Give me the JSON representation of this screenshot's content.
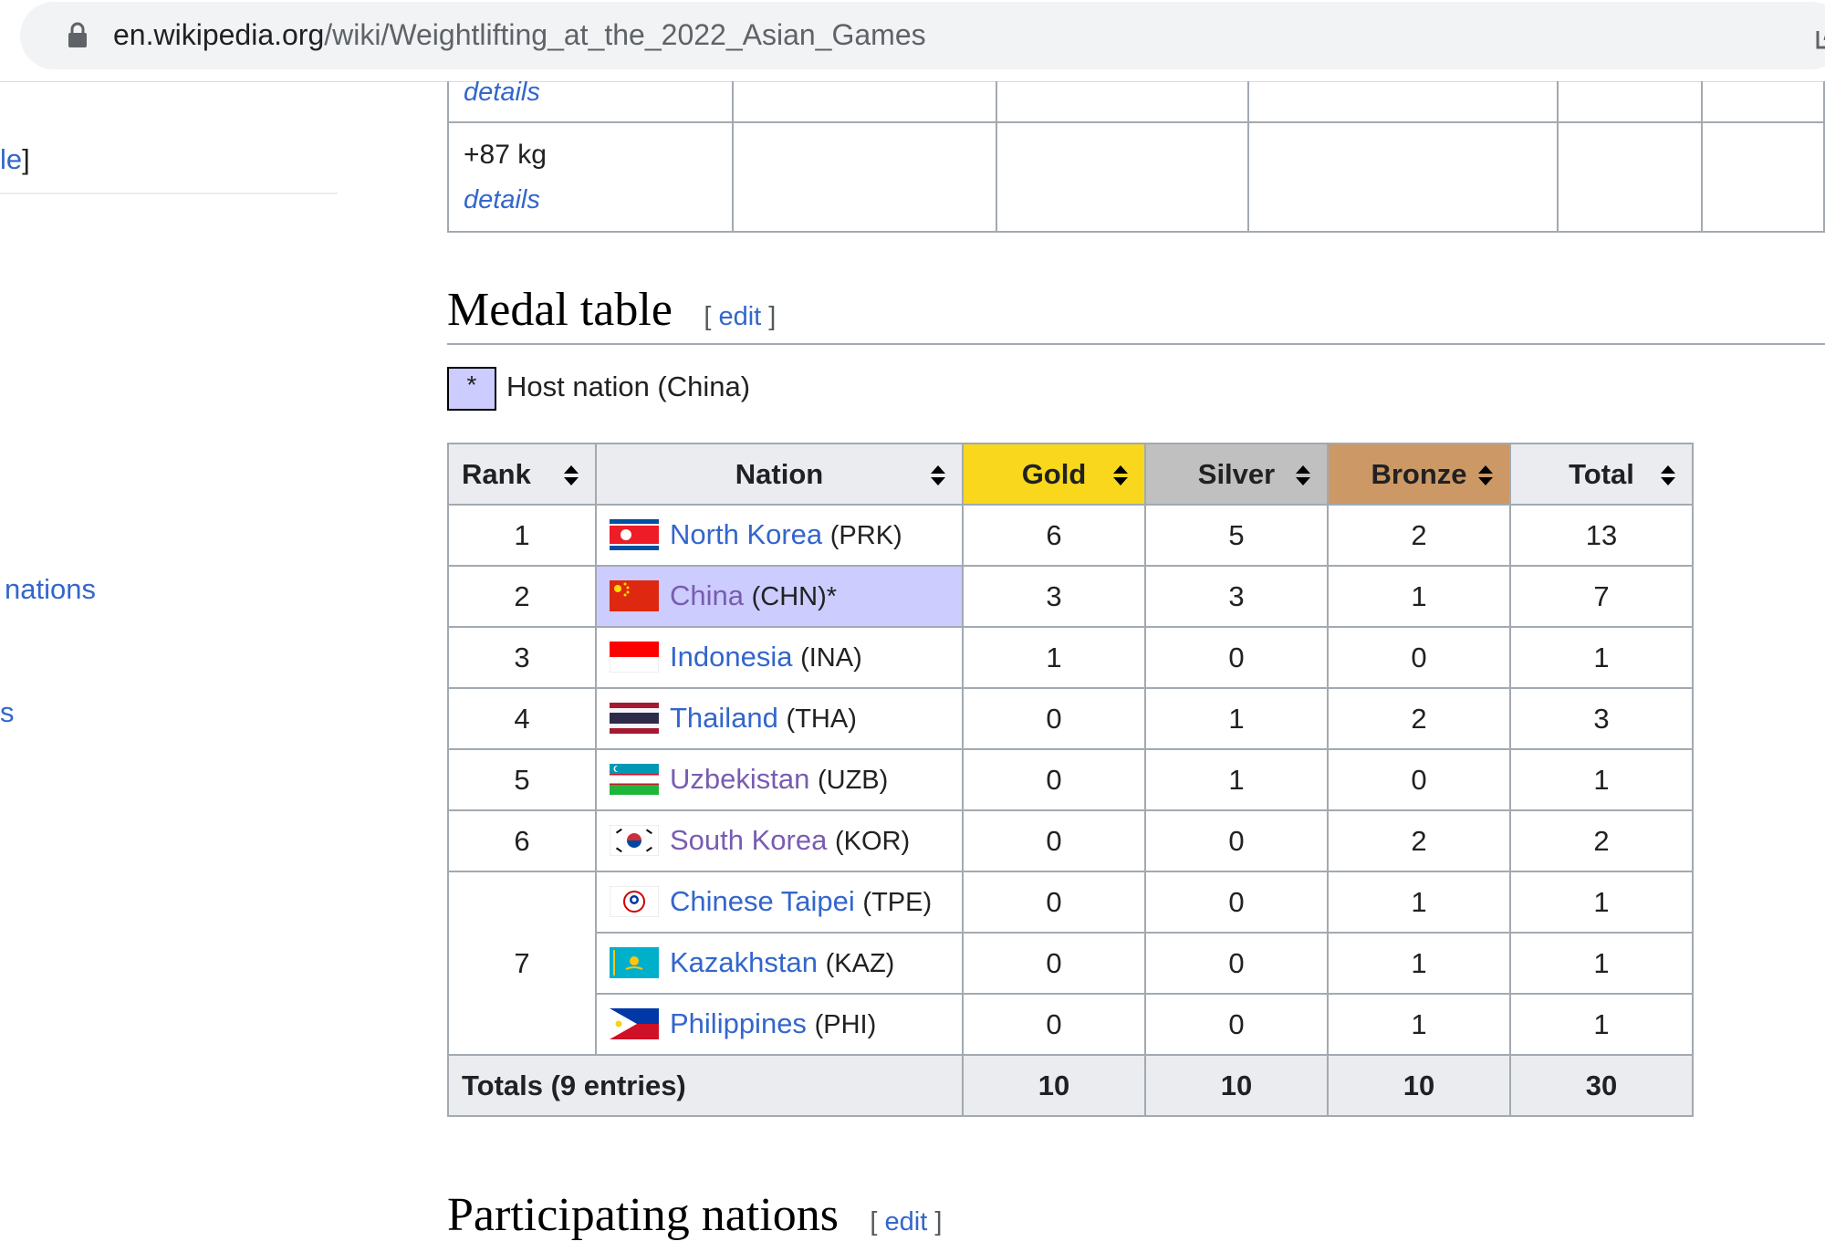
{
  "browser": {
    "url_host": "en.wikipedia.org",
    "url_path": "/wiki/Weightlifting_at_the_2022_Asian_Games"
  },
  "sidebar": {
    "fragments": [
      "le",
      "nations",
      "s"
    ]
  },
  "events_table": {
    "row_partial_link": "details",
    "last_row": {
      "event": "+87 kg",
      "link": "details"
    }
  },
  "medal_section": {
    "title": "Medal table",
    "edit_label": "edit",
    "host_marker": "*",
    "host_note": "Host nation (China)"
  },
  "medal_table": {
    "headers": {
      "rank": "Rank",
      "nation": "Nation",
      "gold": "Gold",
      "silver": "Silver",
      "bronze": "Bronze",
      "total": "Total"
    },
    "rows": [
      {
        "rank": "1",
        "nation": "North Korea",
        "code": "(PRK)",
        "gold": "6",
        "silver": "5",
        "bronze": "2",
        "total": "13"
      },
      {
        "rank": "2",
        "nation": "China",
        "code": "(CHN)*",
        "gold": "3",
        "silver": "3",
        "bronze": "1",
        "total": "7"
      },
      {
        "rank": "3",
        "nation": "Indonesia",
        "code": "(INA)",
        "gold": "1",
        "silver": "0",
        "bronze": "0",
        "total": "1"
      },
      {
        "rank": "4",
        "nation": "Thailand",
        "code": "(THA)",
        "gold": "0",
        "silver": "1",
        "bronze": "2",
        "total": "3"
      },
      {
        "rank": "5",
        "nation": "Uzbekistan",
        "code": "(UZB)",
        "gold": "0",
        "silver": "1",
        "bronze": "0",
        "total": "1"
      },
      {
        "rank": "6",
        "nation": "South Korea",
        "code": "(KOR)",
        "gold": "0",
        "silver": "0",
        "bronze": "2",
        "total": "2"
      },
      {
        "rank": "7",
        "nation": "Chinese Taipei",
        "code": "(TPE)",
        "gold": "0",
        "silver": "0",
        "bronze": "1",
        "total": "1"
      },
      {
        "rank": "",
        "nation": "Kazakhstan",
        "code": "(KAZ)",
        "gold": "0",
        "silver": "0",
        "bronze": "1",
        "total": "1"
      },
      {
        "rank": "",
        "nation": "Philippines",
        "code": "(PHI)",
        "gold": "0",
        "silver": "0",
        "bronze": "1",
        "total": "1"
      }
    ],
    "totals": {
      "label": "Totals (9 entries)",
      "gold": "10",
      "silver": "10",
      "bronze": "10",
      "total": "30"
    }
  },
  "next_section": {
    "title": "Participating nations",
    "edit_label": "edit"
  },
  "colors": {
    "link": "#3366cc",
    "visited_link": "#795cb2",
    "gold_header": "#f9d71c",
    "silver_header": "#c0c0c0",
    "bronze_header": "#cc9966",
    "host_highlight": "#ccccff"
  }
}
